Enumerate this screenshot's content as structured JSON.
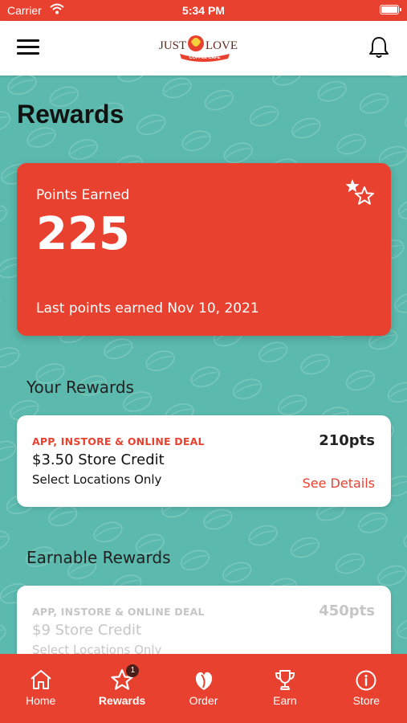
{
  "status_bar": {
    "carrier": "Carrier",
    "time": "5:34 PM"
  },
  "header": {
    "logo_text_top": "JUST",
    "logo_text_love": "LOVE",
    "logo_text_sub": "COFFEE CAFE"
  },
  "page": {
    "title": "Rewards"
  },
  "points_card": {
    "label": "Points Earned",
    "value": "225",
    "last_earned": "Last points earned Nov 10, 2021"
  },
  "your_rewards": {
    "heading": "Your Rewards",
    "items": [
      {
        "deal": "APP, INSTORE & ONLINE DEAL",
        "title": "$3.50 Store Credit",
        "subtitle": "Select Locations Only",
        "points": "210pts",
        "details": "See Details"
      }
    ]
  },
  "earnable_rewards": {
    "heading": "Earnable Rewards",
    "items": [
      {
        "deal": "APP, INSTORE & ONLINE DEAL",
        "title": "$9 Store Credit",
        "subtitle": "Select Locations Only",
        "points": "450pts"
      }
    ]
  },
  "tab_bar": {
    "tabs": [
      {
        "label": "Home",
        "icon": "home-icon"
      },
      {
        "label": "Rewards",
        "icon": "star-icon",
        "badge": "1",
        "active": true
      },
      {
        "label": "Order",
        "icon": "coffee-bean-icon"
      },
      {
        "label": "Earn",
        "icon": "trophy-icon"
      },
      {
        "label": "Store",
        "icon": "info-icon"
      }
    ]
  },
  "colors": {
    "brand_red": "#e8412f",
    "teal_background": "#5bb9ad",
    "badge_dark": "#4a1f1a"
  }
}
